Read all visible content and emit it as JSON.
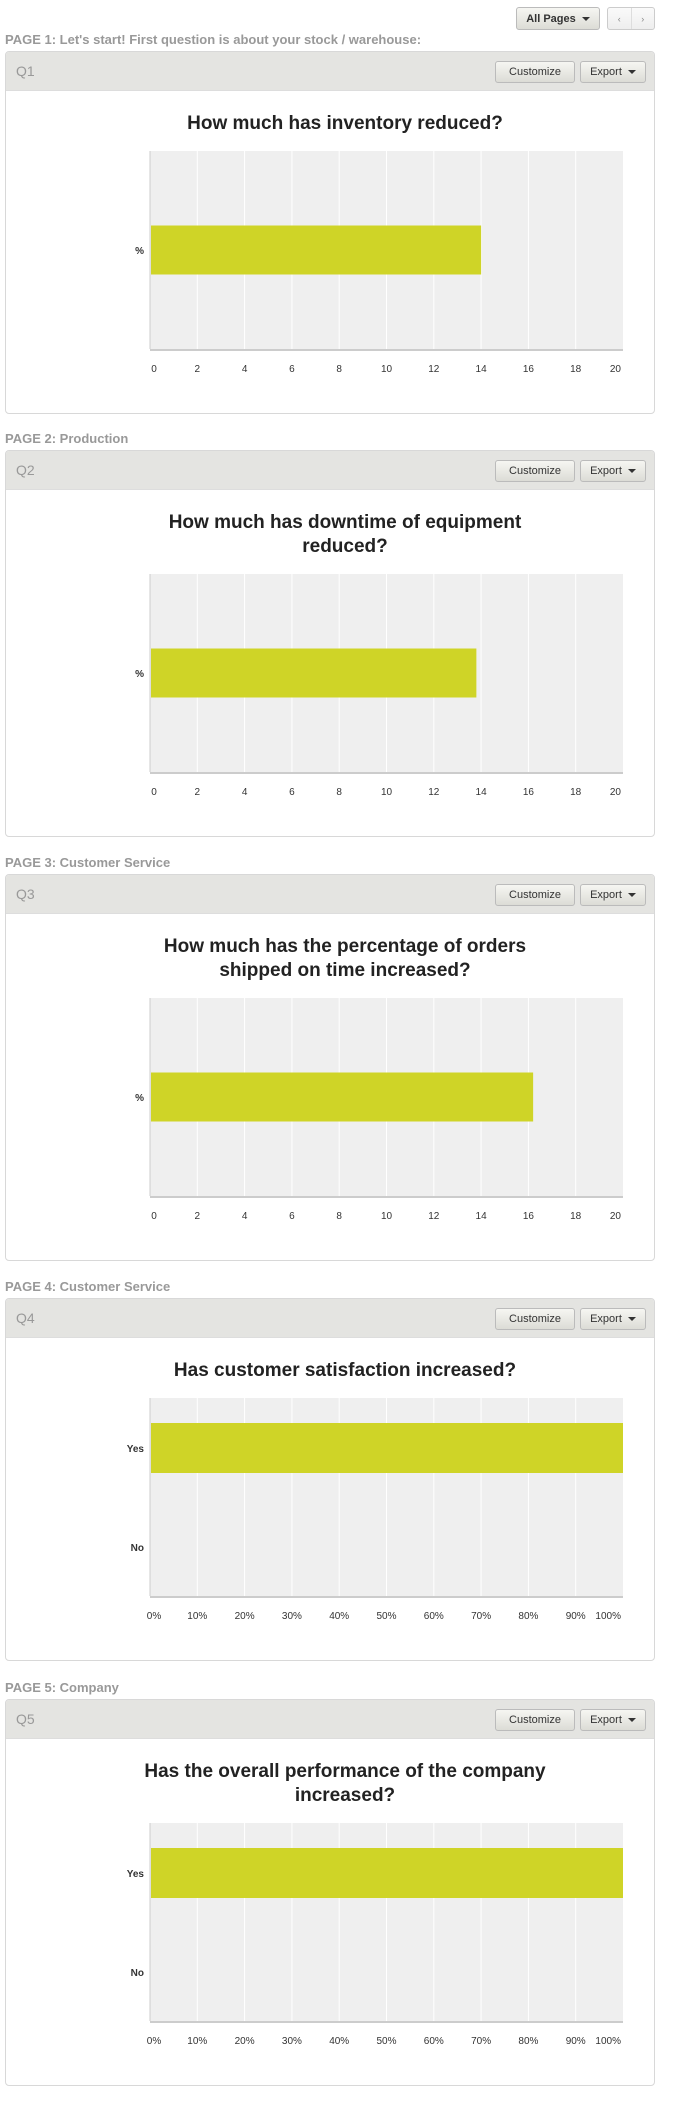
{
  "toolbar": {
    "pages_label": "All Pages",
    "prev": "‹",
    "next": "›"
  },
  "buttons": {
    "customize": "Customize",
    "export": "Export"
  },
  "colors": {
    "bar": "#cfd427",
    "plot_bg": "#efefef",
    "grid": "#ffffff"
  },
  "sections": [
    {
      "page_label": "PAGE 1: Let's start! First question is about your stock / warehouse:",
      "q": "Q1",
      "title": "How much has inventory reduced?"
    },
    {
      "page_label": "PAGE 2: Production",
      "q": "Q2",
      "title": "How much has downtime of equipment reduced?"
    },
    {
      "page_label": "PAGE 3: Customer Service",
      "q": "Q3",
      "title": "How much has the percentage of orders shipped on time increased?"
    },
    {
      "page_label": "PAGE 4: Customer Service",
      "q": "Q4",
      "title": "Has customer satisfaction increased?"
    },
    {
      "page_label": "PAGE 5: Company",
      "q": "Q5",
      "title": "Has the overall performance of the company increased?"
    }
  ],
  "chart_data": [
    {
      "type": "bar",
      "orientation": "horizontal",
      "title": "How much has inventory reduced?",
      "categories": [
        "%"
      ],
      "values": [
        14
      ],
      "xlim": [
        0,
        20
      ],
      "ticks": [
        "0",
        "2",
        "4",
        "6",
        "8",
        "10",
        "12",
        "14",
        "16",
        "18",
        "20"
      ],
      "grid": true
    },
    {
      "type": "bar",
      "orientation": "horizontal",
      "title": "How much has downtime of equipment reduced?",
      "categories": [
        "%"
      ],
      "values": [
        13.8
      ],
      "xlim": [
        0,
        20
      ],
      "ticks": [
        "0",
        "2",
        "4",
        "6",
        "8",
        "10",
        "12",
        "14",
        "16",
        "18",
        "20"
      ],
      "grid": true
    },
    {
      "type": "bar",
      "orientation": "horizontal",
      "title": "How much has the percentage of orders shipped on time increased?",
      "categories": [
        "%"
      ],
      "values": [
        16.2
      ],
      "xlim": [
        0,
        20
      ],
      "ticks": [
        "0",
        "2",
        "4",
        "6",
        "8",
        "10",
        "12",
        "14",
        "16",
        "18",
        "20"
      ],
      "grid": true
    },
    {
      "type": "bar",
      "orientation": "horizontal",
      "title": "Has customer satisfaction increased?",
      "categories": [
        "Yes",
        "No"
      ],
      "values": [
        100,
        0
      ],
      "xlim": [
        0,
        100
      ],
      "ticks": [
        "0%",
        "10%",
        "20%",
        "30%",
        "40%",
        "50%",
        "60%",
        "70%",
        "80%",
        "90%",
        "100%"
      ],
      "grid": true
    },
    {
      "type": "bar",
      "orientation": "horizontal",
      "title": "Has the overall performance of the company increased?",
      "categories": [
        "Yes",
        "No"
      ],
      "values": [
        100,
        0
      ],
      "xlim": [
        0,
        100
      ],
      "ticks": [
        "0%",
        "10%",
        "20%",
        "30%",
        "40%",
        "50%",
        "60%",
        "70%",
        "80%",
        "90%",
        "100%"
      ],
      "grid": true
    }
  ]
}
